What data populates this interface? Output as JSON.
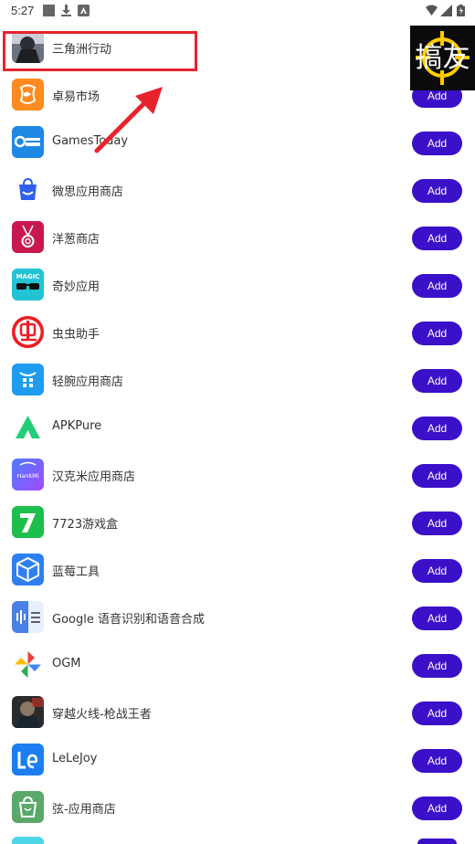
{
  "status_bar": {
    "time": "5:27"
  },
  "apps": [
    {
      "name": "三角洲行动",
      "icon": "delta-force-icon",
      "add": ""
    },
    {
      "name": "卓易市场",
      "icon": "zhuoyi-market-icon",
      "add": "Add"
    },
    {
      "name": "GamesToday",
      "icon": "gamestoday-icon",
      "add": "Add"
    },
    {
      "name": "微思应用商店",
      "icon": "weisi-store-icon",
      "add": "Add"
    },
    {
      "name": "洋葱商店",
      "icon": "onion-store-icon",
      "add": "Add"
    },
    {
      "name": "奇妙应用",
      "icon": "magic-app-icon",
      "add": "Add"
    },
    {
      "name": "虫虫助手",
      "icon": "chongchong-icon",
      "add": "Add"
    },
    {
      "name": "轻腕应用商店",
      "icon": "qingwan-store-icon",
      "add": "Add"
    },
    {
      "name": "APKPure",
      "icon": "apkpure-icon",
      "add": "Add"
    },
    {
      "name": "汉克米应用商店",
      "icon": "hankmi-store-icon",
      "add": "Add"
    },
    {
      "name": "7723游戏盒",
      "icon": "7723-game-box-icon",
      "add": "Add"
    },
    {
      "name": "蓝莓工具",
      "icon": "blueberry-tool-icon",
      "add": "Add"
    },
    {
      "name": "Google 语音识别和语音合成",
      "icon": "google-speech-icon",
      "add": "Add"
    },
    {
      "name": "OGM",
      "icon": "ogm-icon",
      "add": "Add"
    },
    {
      "name": "穿越火线-枪战王者",
      "icon": "crossfire-icon",
      "add": "Add"
    },
    {
      "name": "LeLeJoy",
      "icon": "lelejoy-icon",
      "add": "Add"
    },
    {
      "name": "弦-应用商店",
      "icon": "xian-store-icon",
      "add": "Add"
    }
  ],
  "watermark": {
    "text": "搞友"
  },
  "colors": {
    "add_button": "#3a10c8",
    "highlight": "#e8232c"
  }
}
